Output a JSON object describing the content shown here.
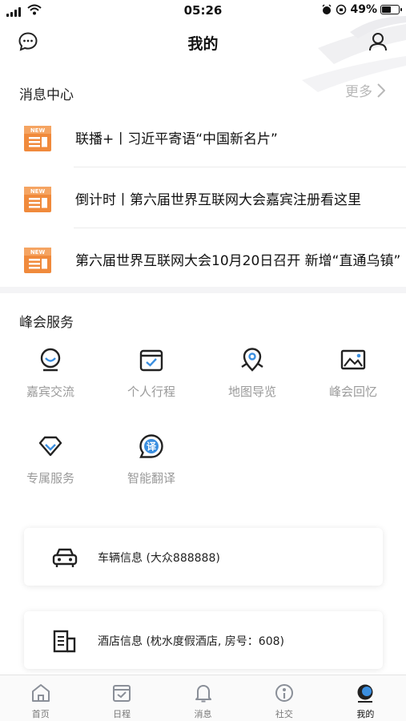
{
  "status_bar": {
    "time": "05:26",
    "battery_text": "49%",
    "battery_level": 0.49
  },
  "nav": {
    "title": "我的",
    "left_icon": "message-bubble-icon",
    "right_icon": "user-icon"
  },
  "message_center": {
    "title": "消息中心",
    "more_label": "更多",
    "items": [
      {
        "text": "联播+丨习近平寄语“中国新名片”",
        "badge": "NEW"
      },
      {
        "text": "倒计时丨第六届世界互联网大会嘉宾注册看这里",
        "badge": "NEW"
      },
      {
        "text": "第六届世界互联网大会10月20日召开 新增“直通乌镇”",
        "badge": "NEW"
      }
    ]
  },
  "summit_services": {
    "title": "峰会服务",
    "items": [
      {
        "label": "嘉宾交流",
        "icon": "guest-face-icon"
      },
      {
        "label": "个人行程",
        "icon": "schedule-check-icon"
      },
      {
        "label": "地图导览",
        "icon": "map-pin-icon"
      },
      {
        "label": "峰会回忆",
        "icon": "image-icon"
      },
      {
        "label": "专属服务",
        "icon": "diamond-icon"
      },
      {
        "label": "智能翻译",
        "icon": "translate-icon"
      }
    ]
  },
  "cards": {
    "vehicle": {
      "text": "车辆信息 (大众888888)",
      "icon": "car-icon"
    },
    "hotel": {
      "text": "酒店信息 (枕水度假酒店, 房号：608)",
      "icon": "hotel-building-icon"
    }
  },
  "tab_bar": {
    "active": "我的",
    "tabs": [
      {
        "label": "首页",
        "icon": "home-icon"
      },
      {
        "label": "日程",
        "icon": "calendar-icon"
      },
      {
        "label": "消息",
        "icon": "bell-icon"
      },
      {
        "label": "社交",
        "icon": "social-icon"
      },
      {
        "label": "我的",
        "icon": "profile-icon"
      }
    ]
  },
  "colors": {
    "accent": "#3b8fe0",
    "news_badge": "#f08a3c"
  }
}
